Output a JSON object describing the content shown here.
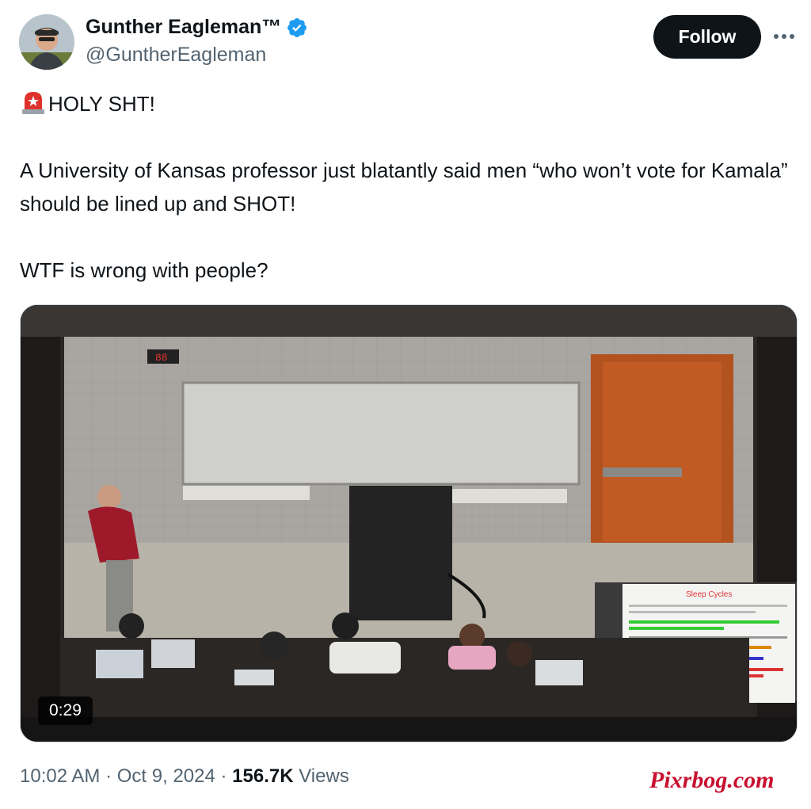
{
  "author": {
    "display_name": "Gunther Eagleman™",
    "handle": "@GuntherEagleman",
    "verified": true,
    "avatar_icon": "profile-avatar",
    "verified_icon": "verified-badge-icon",
    "verified_color": "#1d9bf0"
  },
  "actions": {
    "follow_label": "Follow",
    "more_icon": "more-options-icon"
  },
  "tweet": {
    "siren_icon": "rotating-light-emoji",
    "line1": "HOLY SHT!",
    "line2": "A University of Kansas professor just blatantly said men “who won’t vote for Kamala” should be lined up and SHOT!",
    "line3": "WTF is wrong with people?"
  },
  "media": {
    "type": "video",
    "duration": "0:29",
    "slide_title": "Sleep Cycles"
  },
  "meta": {
    "time": "10:02 AM",
    "separator": "·",
    "date": "Oct 9, 2024",
    "views_count": "156.7K",
    "views_label": "Views"
  },
  "watermark": "Pixrbog.com"
}
